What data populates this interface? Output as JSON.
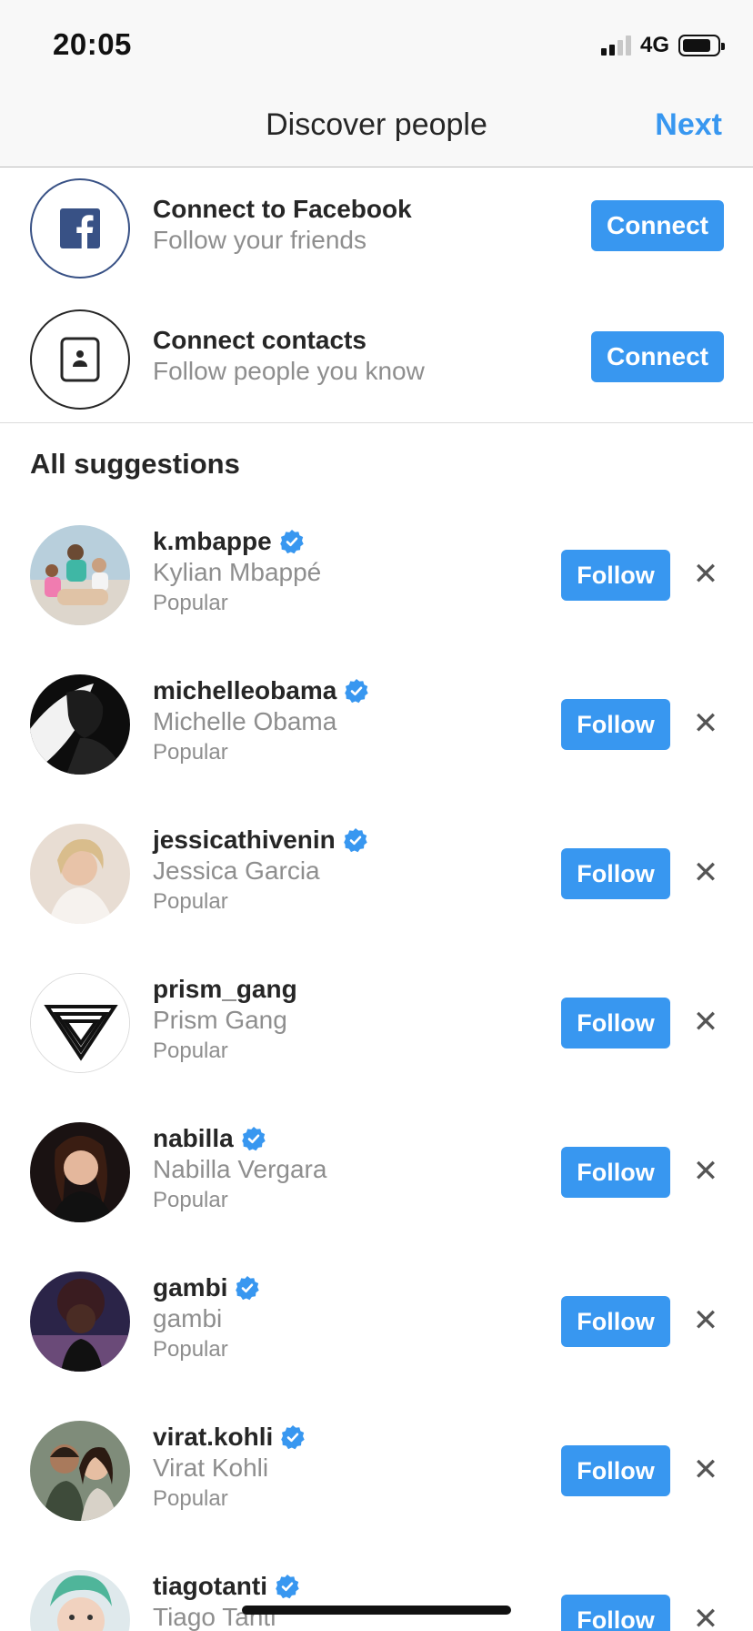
{
  "status_bar": {
    "time": "20:05",
    "network": "4G"
  },
  "nav": {
    "title": "Discover people",
    "next_label": "Next"
  },
  "connect_rows": [
    {
      "title": "Connect to Facebook",
      "subtitle": "Follow your friends",
      "button": "Connect",
      "icon": "facebook-icon"
    },
    {
      "title": "Connect contacts",
      "subtitle": "Follow people you know",
      "button": "Connect",
      "icon": "contacts-icon"
    }
  ],
  "section": {
    "title": "All suggestions"
  },
  "suggestions": [
    {
      "username": "k.mbappe",
      "full_name": "Kylian Mbappé",
      "reason": "Popular",
      "verified": true,
      "follow": "Follow"
    },
    {
      "username": "michelleobama",
      "full_name": "Michelle Obama",
      "reason": "Popular",
      "verified": true,
      "follow": "Follow"
    },
    {
      "username": "jessicathivenin",
      "full_name": "Jessica Garcia",
      "reason": "Popular",
      "verified": true,
      "follow": "Follow"
    },
    {
      "username": "prism_gang",
      "full_name": "Prism Gang",
      "reason": "Popular",
      "verified": false,
      "follow": "Follow"
    },
    {
      "username": "nabilla",
      "full_name": "Nabilla Vergara",
      "reason": "Popular",
      "verified": true,
      "follow": "Follow"
    },
    {
      "username": "gambi",
      "full_name": "gambi",
      "reason": "Popular",
      "verified": true,
      "follow": "Follow"
    },
    {
      "username": "virat.kohli",
      "full_name": "Virat Kohli",
      "reason": "Popular",
      "verified": true,
      "follow": "Follow"
    },
    {
      "username": "tiagotanti",
      "full_name": "Tiago Tanti",
      "reason": "",
      "verified": true,
      "follow": "Follow"
    }
  ],
  "dismiss_glyph": "✕",
  "colors": {
    "accent": "#3897f0",
    "text": "#262626",
    "secondary": "#8e8e8e",
    "facebook": "#385185"
  }
}
